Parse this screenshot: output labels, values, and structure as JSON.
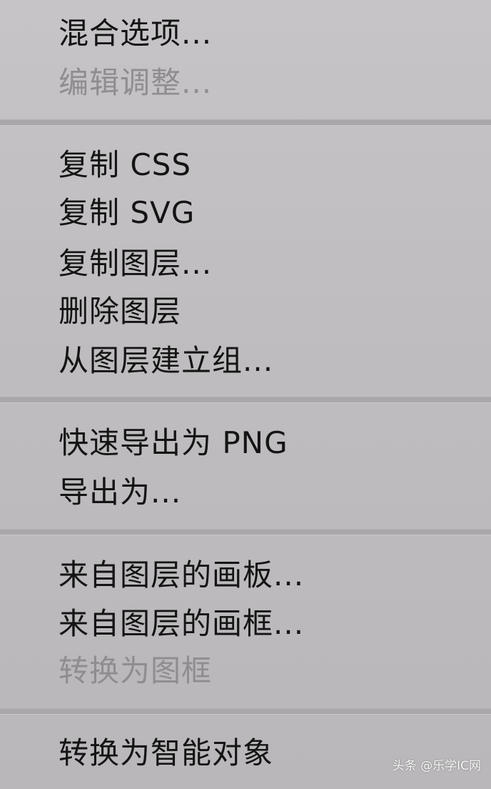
{
  "menu": {
    "group1": [
      {
        "label": "混合选项...",
        "enabled": true
      },
      {
        "label": "编辑调整...",
        "enabled": false
      }
    ],
    "group2": [
      {
        "label": "复制 CSS",
        "enabled": true
      },
      {
        "label": "复制 SVG",
        "enabled": true
      },
      {
        "label": "复制图层...",
        "enabled": true
      },
      {
        "label": "删除图层",
        "enabled": true
      },
      {
        "label": "从图层建立组...",
        "enabled": true
      }
    ],
    "group3": [
      {
        "label": "快速导出为 PNG",
        "enabled": true
      },
      {
        "label": "导出为...",
        "enabled": true
      }
    ],
    "group4": [
      {
        "label": "来自图层的画板...",
        "enabled": true
      },
      {
        "label": "来自图层的画框...",
        "enabled": true
      },
      {
        "label": "转换为图框",
        "enabled": false
      }
    ],
    "group5": [
      {
        "label": "转换为智能对象",
        "enabled": true
      }
    ]
  },
  "watermark": {
    "text": "头条 @乐学IC网"
  }
}
